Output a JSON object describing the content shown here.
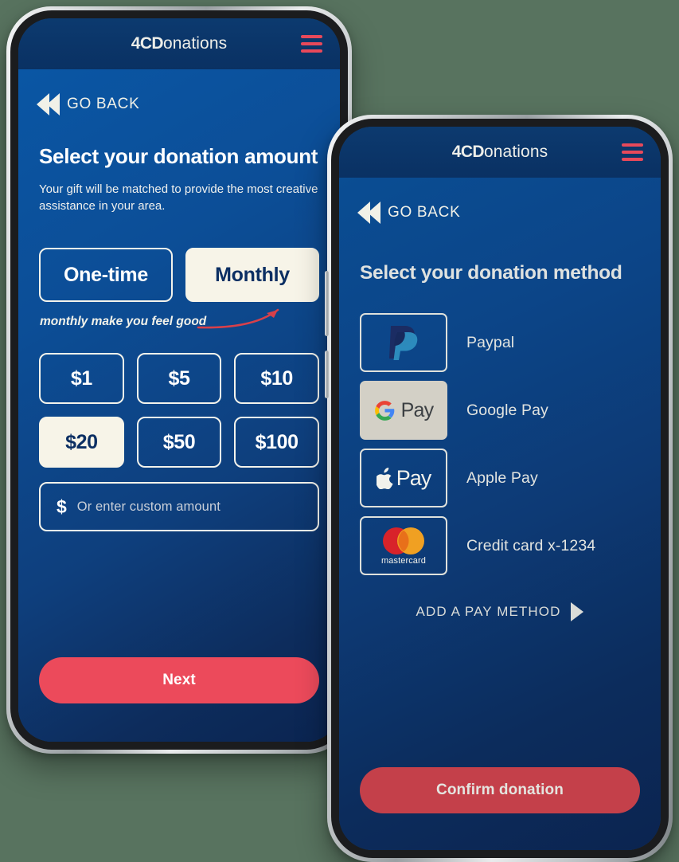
{
  "brand": {
    "bold": "4CD",
    "light": "onations"
  },
  "icons": {
    "hamburger": "hamburger-menu-icon",
    "back": "double-chevron-left-icon",
    "forward": "play-triangle-right-icon"
  },
  "phone1": {
    "nav": {
      "back_label": "GO BACK"
    },
    "title": "Select your donation amount",
    "subtitle": "Your gift will be matched to provide the most creative assistance in your area.",
    "frequency": {
      "options": [
        {
          "label": "One-time",
          "selected": false
        },
        {
          "label": "Monthly",
          "selected": true
        }
      ]
    },
    "annotation": {
      "text": "monthly make you feel good",
      "arrow_color": "#d8404a"
    },
    "amounts": [
      {
        "label": "$1",
        "selected": false
      },
      {
        "label": "$5",
        "selected": false
      },
      {
        "label": "$10",
        "selected": false
      },
      {
        "label": "$20",
        "selected": true
      },
      {
        "label": "$50",
        "selected": false
      },
      {
        "label": "$100",
        "selected": false
      }
    ],
    "custom_amount": {
      "symbol": "$",
      "placeholder": "Or enter custom amount",
      "value": ""
    },
    "cta": {
      "label": "Next",
      "color": "#ec4a5b"
    }
  },
  "phone2": {
    "nav": {
      "back_label": "GO BACK"
    },
    "title": "Select your donation method",
    "methods": [
      {
        "label": "Paypal",
        "logo": "paypal-logo",
        "selected": false
      },
      {
        "label": "Google Pay",
        "logo": "google-pay-logo",
        "selected": true
      },
      {
        "label": "Apple Pay",
        "logo": "apple-pay-logo",
        "selected": false
      },
      {
        "label": "Credit card x-1234",
        "logo": "mastercard-logo",
        "selected": false
      }
    ],
    "add_method": {
      "label": "ADD A PAY METHOD"
    },
    "cta": {
      "label": "Confirm donation",
      "color": "#c4404a"
    }
  },
  "theme": {
    "background": "#58735f",
    "accent_red": "#ec4a5b",
    "brand_blue": "#0a4d93",
    "selected_cream": "#f7f4e8"
  },
  "logos": {
    "mastercard_wordmark": "mastercard",
    "google_pay_text": "Pay",
    "apple_pay_text": "Pay"
  }
}
